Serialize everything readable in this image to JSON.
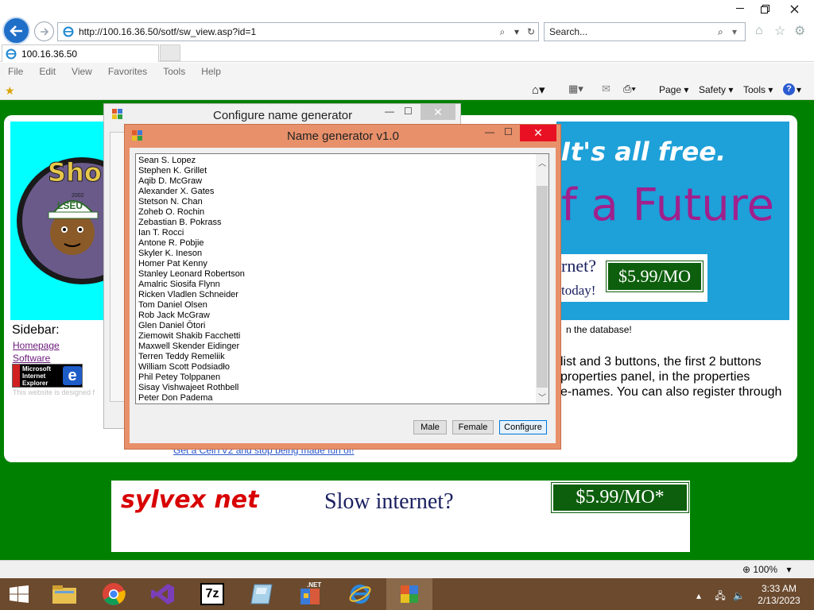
{
  "browser": {
    "url": "http://100.16.36.50/sotf/sw_view.asp?id=1",
    "search_placeholder": "Search...",
    "tab_title": "100.16.36.50",
    "menu": [
      "File",
      "Edit",
      "View",
      "Favorites",
      "Tools",
      "Help"
    ],
    "cmd_page": "Page ▾",
    "cmd_safety": "Safety ▾",
    "cmd_tools": "Tools ▾",
    "zoom": "100%"
  },
  "page": {
    "free_text": "It's all free.",
    "future_text": "f a Future",
    "inet_question": "rnet?",
    "inet_today": "today!",
    "price_small": "$5.99/MO",
    "db_text": "n the database!",
    "desc_lines": [
      "list and 3 buttons, the first 2 buttons",
      " properties panel, in the properties",
      "e-names. You can also register through"
    ],
    "sidebar_title": "Sidebar:",
    "sidebar_links": [
      "Homepage",
      "Software"
    ],
    "ie_badge": [
      "Microsoft",
      "Internet",
      "Explorer"
    ],
    "footnote": "This website is designed f",
    "cellv2_link": "Get a CellTV2 and stop being made fun of!",
    "ad_brand": "sylvex net",
    "ad_slow": "Slow internet?",
    "ad_price": "$5.99/MO*",
    "left_banner_text": "Sho",
    "left_banner_hat": "LSEU",
    "left_banner_year": "2002"
  },
  "config_window": {
    "title": "Configure name generator"
  },
  "generator_window": {
    "title": "Name generator v1.0",
    "names": [
      "Sean S. Lopez",
      "Stephen K. Grillet",
      "Aqib D. McGraw",
      "Alexander X. Gates",
      "Stetson N. Chan",
      "Zoheb O. Rochin",
      "Zebastian B. Pokrass",
      "Ian T. Rocci",
      "Antone R. Pobjie",
      "Skyler K. Ineson",
      "Homer Pat Kenny",
      "Stanley Leonard Robertson",
      "Amalric Siosifa Flynn",
      "Ricken Vladlen Schneider",
      "Tom Daniel Olsen",
      "Rob Jack McGraw",
      "Glen Daniel Ōtori",
      "Ziemowit Shakib Facchetti",
      "Maxwell Skender Eidinger",
      "Terren Teddy Remeliik",
      "William Scott Podsiadło",
      "Phil Petey Tolppanen",
      "Sisay Vishwajeet Rothbell",
      "Peter Don Padema"
    ],
    "btn_male": "Male",
    "btn_female": "Female",
    "btn_configure": "Configure"
  },
  "taskbar": {
    "time": "3:33 AM",
    "date": "2/13/2023",
    "net_badge": ".NET",
    "sevenzip": "7z"
  },
  "colors": {
    "page_green": "#008000",
    "window_accent": "#e8906a",
    "close_red": "#e81123",
    "taskbar": "#6b4a2e"
  }
}
